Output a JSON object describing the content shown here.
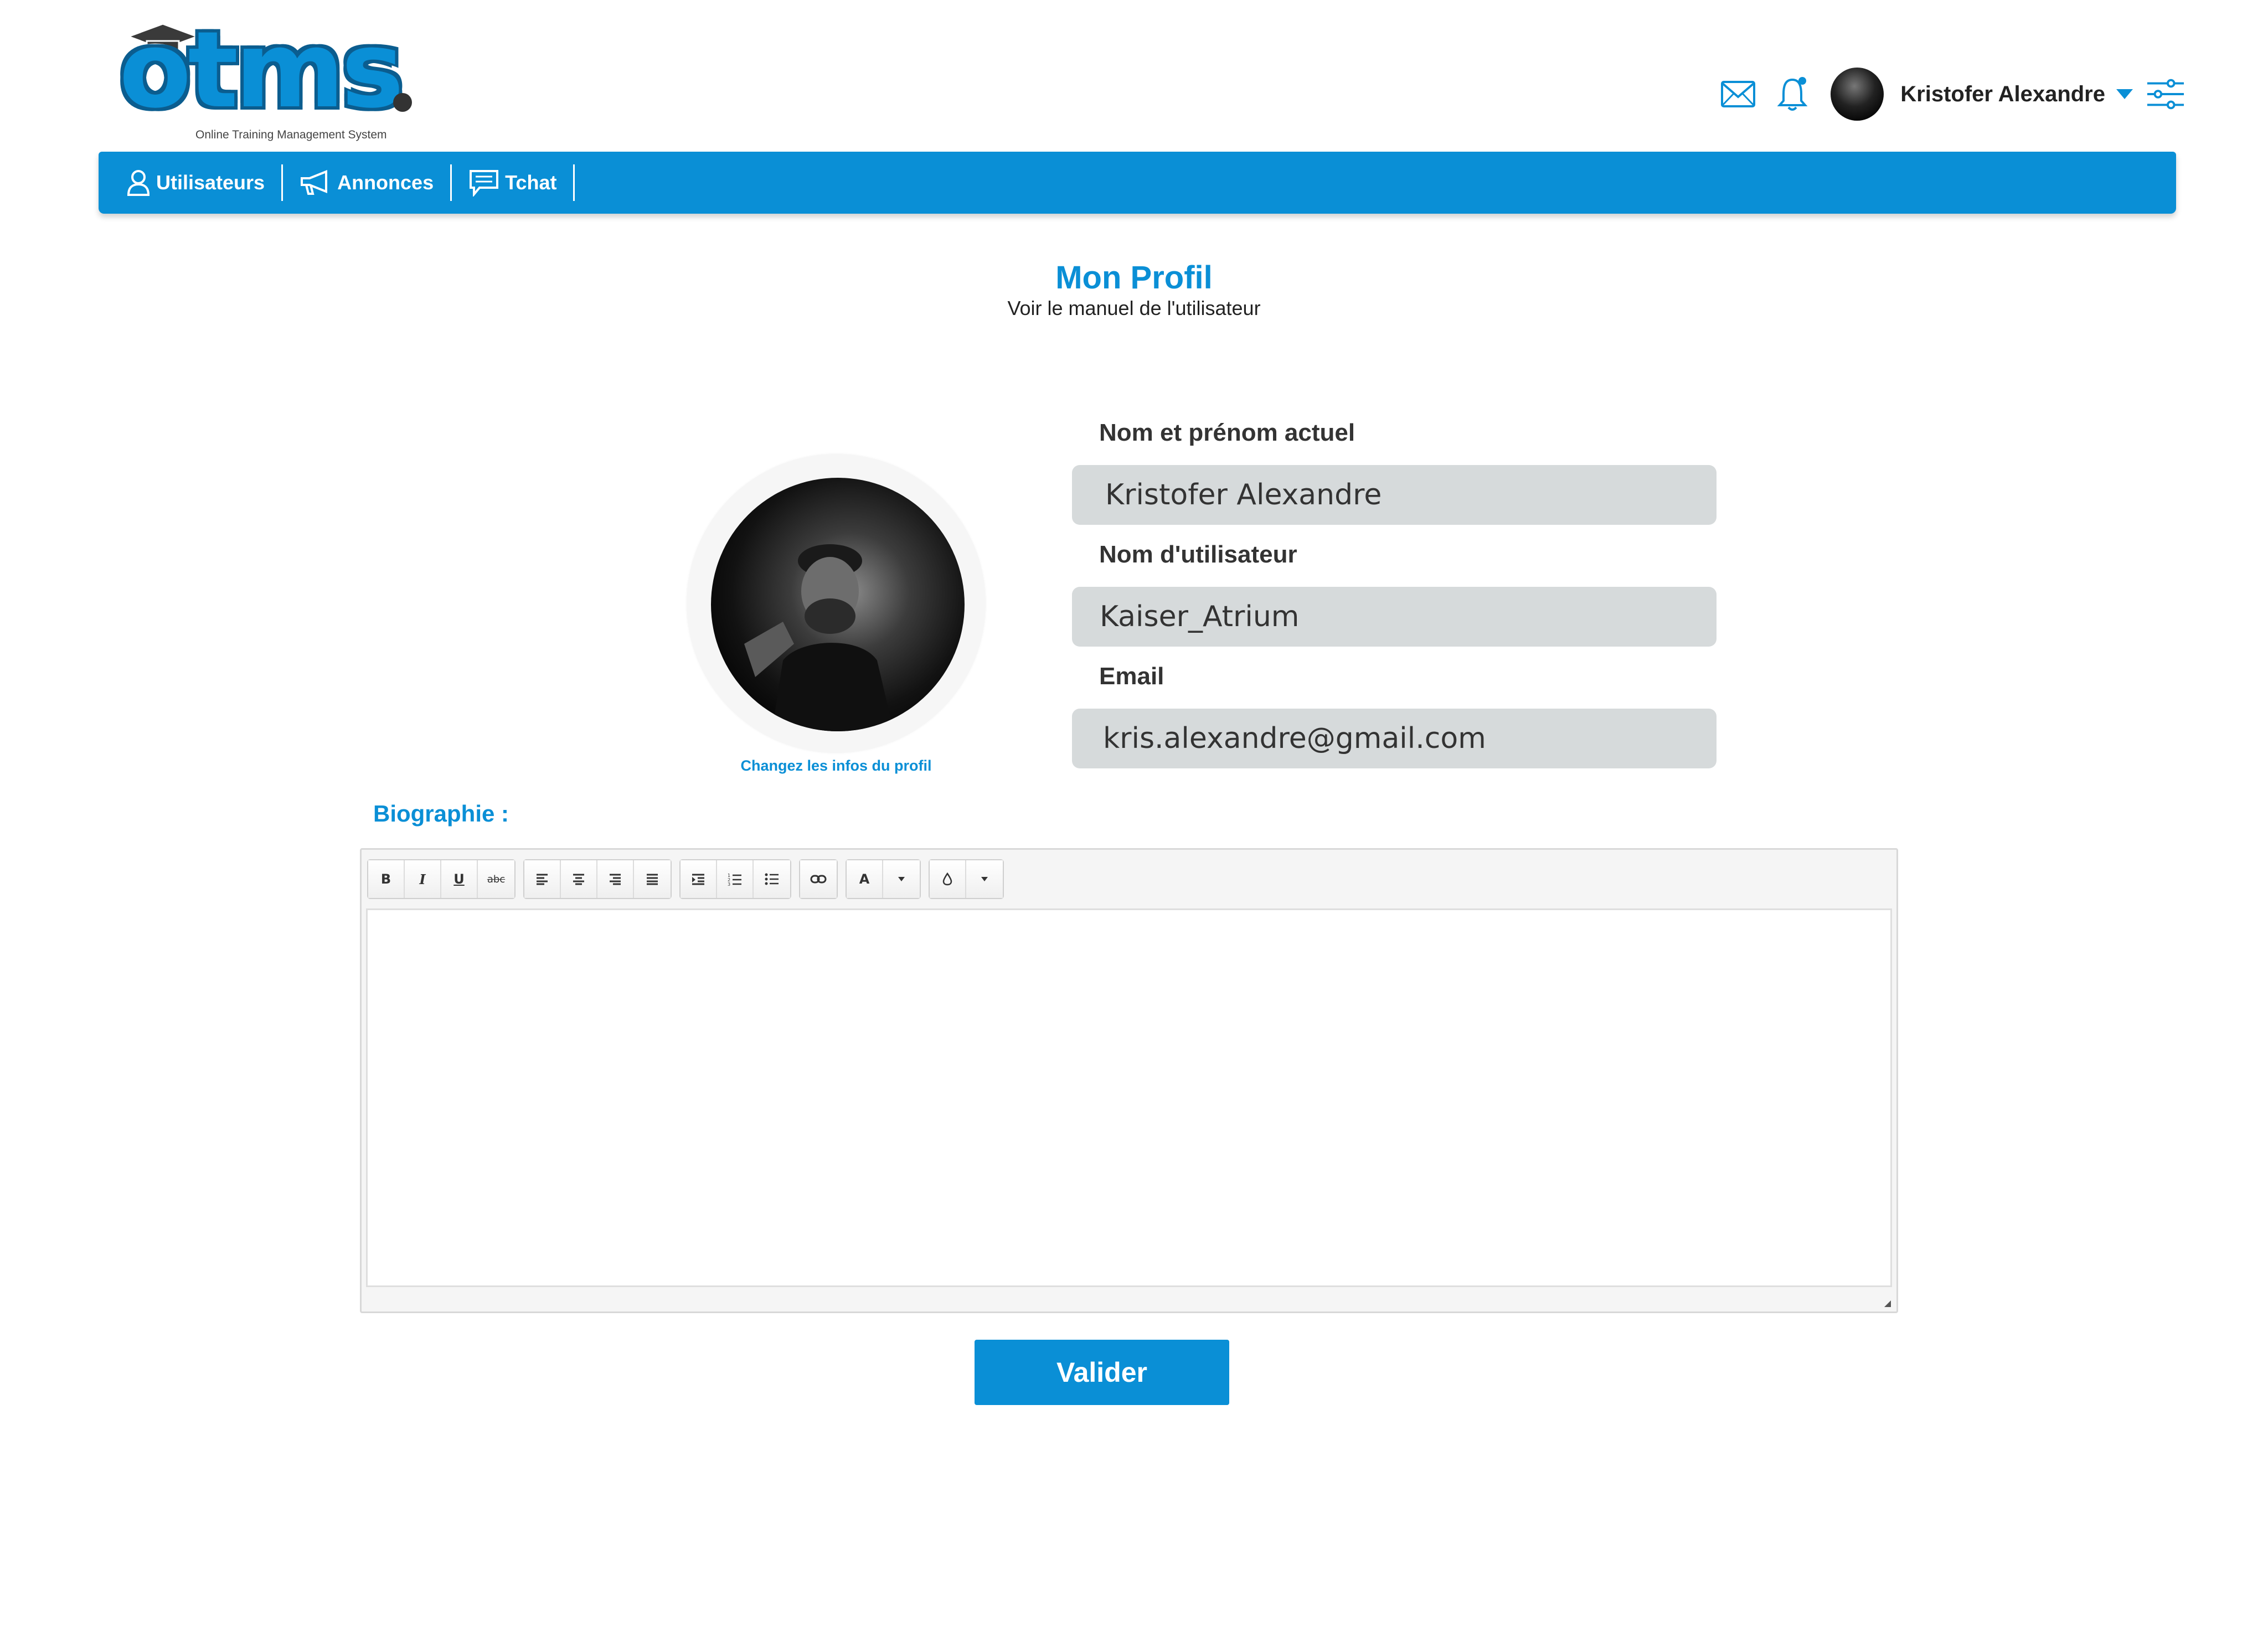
{
  "logo": {
    "wordmark": "otms",
    "tagline": "Online Training Management System"
  },
  "header": {
    "icons": [
      "mail-icon",
      "bell-icon",
      "settings-sliders-icon"
    ],
    "user_name": "Kristofer Alexandre"
  },
  "nav": {
    "items": [
      {
        "label": "Utilisateurs",
        "icon": "user-icon"
      },
      {
        "label": "Annonces",
        "icon": "megaphone-icon"
      },
      {
        "label": "Tchat",
        "icon": "chat-icon"
      }
    ]
  },
  "page": {
    "title": "Mon Profil",
    "subtitle": "Voir le manuel de l'utilisateur"
  },
  "profile": {
    "change_link": "Changez les infos du profil"
  },
  "form": {
    "fullname_label": "Nom et prénom actuel",
    "fullname_value": "Kristofer Alexandre",
    "username_label": "Nom d'utilisateur",
    "username_value": "Kaiser_Atrium",
    "email_label": "Email",
    "email_value": "kris.alexandre@gmail.com"
  },
  "bio": {
    "label": "Biographie :",
    "toolbar": {
      "bold": "B",
      "italic": "I",
      "underline": "U",
      "strike": "abc",
      "font_color": "A"
    },
    "content": ""
  },
  "submit_label": "Valider",
  "colors": {
    "accent": "#0a8fd6",
    "field_bg": "#d6dadb"
  }
}
